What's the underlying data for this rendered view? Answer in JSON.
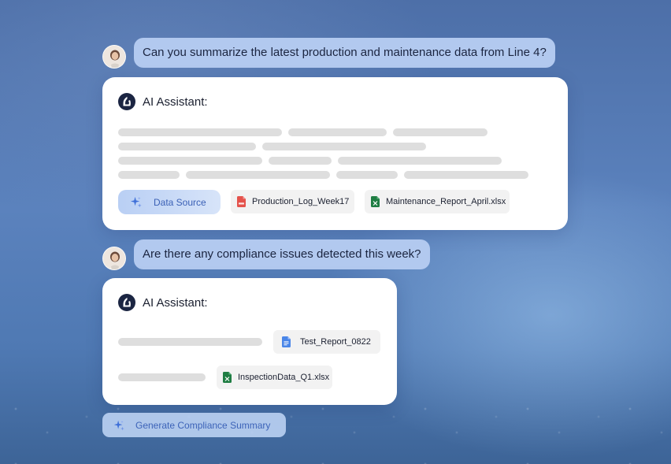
{
  "conversation": {
    "user_message_1": "Can you summarize the latest production and maintenance data from Line 4?",
    "ai_label_1": "AI Assistant:",
    "data_source_label": "Data Source",
    "attachments_1": [
      {
        "name": "Production_Log_Week17",
        "type": "pdf"
      },
      {
        "name": "Maintenance_Report_April.xlsx",
        "type": "xlsx"
      }
    ],
    "user_message_2": "Are there any compliance issues detected this week?",
    "ai_label_2": "AI Assistant:",
    "attachments_2": [
      {
        "name": "Test_Report_0822",
        "type": "doc"
      },
      {
        "name": "InspectionData_Q1.xlsx",
        "type": "xlsx"
      }
    ],
    "action_button_label": "Generate Compliance Summary"
  },
  "icons": {
    "user_avatar": "user-avatar-photo",
    "ai_logo": "assistant-logo-icon",
    "sparkle": "sparkle-icon",
    "pdf": "pdf-file-icon",
    "excel": "excel-file-icon",
    "doc": "google-doc-icon"
  },
  "colors": {
    "user_bubble": "#b2c9ef",
    "accent_blue": "#3b61b6",
    "skeleton": "#dedede",
    "chip_bg": "#f2f2f2",
    "pdf_red": "#e4524b",
    "excel_green": "#1f7d43",
    "doc_blue": "#4a86e8"
  }
}
